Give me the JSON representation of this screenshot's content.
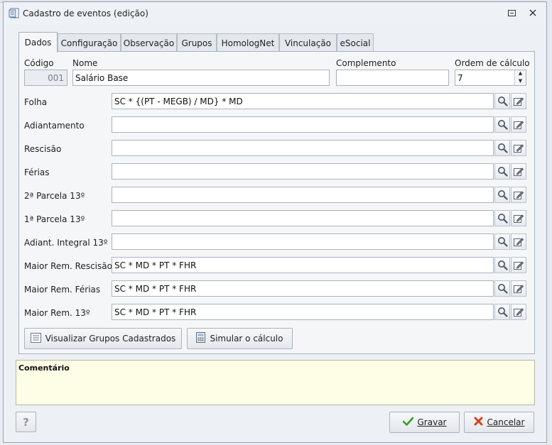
{
  "window": {
    "title": "Cadastro de eventos (edição)"
  },
  "tabs": [
    "Dados",
    "Configuração",
    "Observação",
    "Grupos",
    "HomologNet",
    "Vinculação",
    "eSocial"
  ],
  "form": {
    "codigo_label": "Código",
    "codigo_value": "001",
    "nome_label": "Nome",
    "nome_value": "Salário Base",
    "complemento_label": "Complemento",
    "complemento_value": "",
    "ordem_label": "Ordem de cálculo",
    "ordem_value": "7"
  },
  "formulas": [
    {
      "label": "Folha",
      "value": "SC * {(PT - MEGB) / MD} * MD"
    },
    {
      "label": "Adiantamento",
      "value": ""
    },
    {
      "label": "Rescisão",
      "value": ""
    },
    {
      "label": "Férias",
      "value": ""
    },
    {
      "label": "2ª Parcela 13º",
      "value": ""
    },
    {
      "label": "1ª Parcela 13º",
      "value": ""
    },
    {
      "label": "Adiant. Integral 13º",
      "value": ""
    },
    {
      "label": "Maior Rem. Rescisão",
      "value": "SC * MD * PT * FHR"
    },
    {
      "label": "Maior Rem. Férias",
      "value": "SC * MD * PT * FHR"
    },
    {
      "label": "Maior Rem. 13º",
      "value": "SC * MD * PT * FHR"
    }
  ],
  "buttons": {
    "visualizar": "Visualizar Grupos Cadastrados",
    "simular": "Simular o cálculo",
    "help": "?",
    "gravar": "Gravar",
    "cancelar": "Cancelar"
  },
  "comment": {
    "title": "Comentário",
    "value": ""
  },
  "icons": {
    "title": "form-icon",
    "minimize": "restore-icon",
    "close": "close-icon",
    "search": "magnifier-icon",
    "edit": "edit-formula-icon",
    "visualizar": "list-icon",
    "simular": "calculator-icon",
    "gravar": "check-icon",
    "cancelar": "x-icon"
  },
  "colors": {
    "comment_bg": "#fefee6",
    "check": "#3a9a2a",
    "cancel": "#d8401c"
  }
}
